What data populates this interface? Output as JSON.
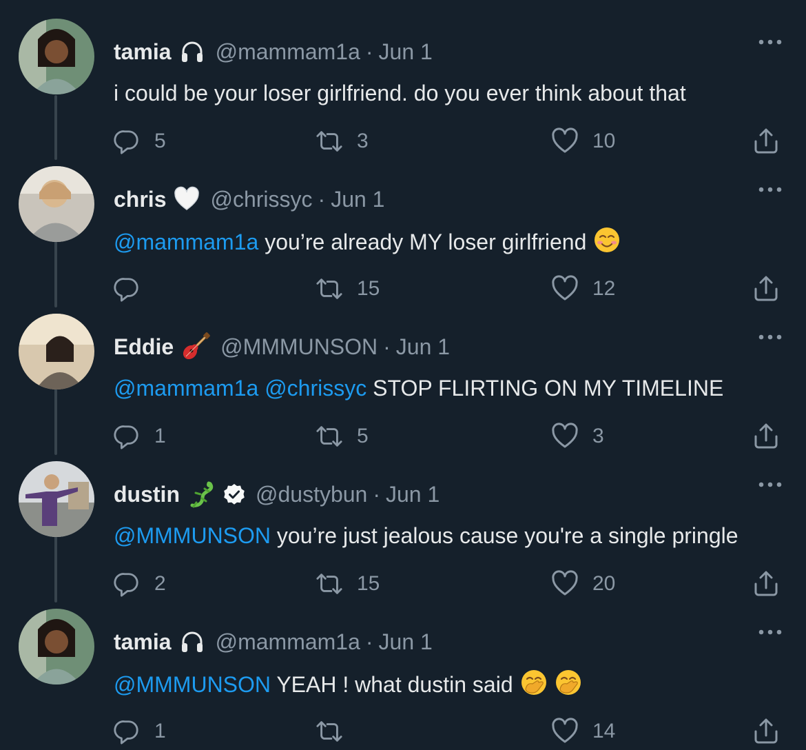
{
  "colors": {
    "background": "#15202b",
    "text": "#e7e9ea",
    "muted": "#8b98a5",
    "mention": "#1d9bf0",
    "thread_line": "#38444d"
  },
  "tweets": [
    {
      "name": "tamia",
      "name_emoji": "headphones-icon",
      "handle": "@mammam1a",
      "separator": "·",
      "date": "Jun 1",
      "mentions": [],
      "text": "i could be your loser girlfriend. do you ever think about that",
      "text_emojis": [],
      "reply_count": "5",
      "retweet_count": "3",
      "like_count": "10"
    },
    {
      "name": "chris",
      "name_emoji": "white-heart-icon",
      "handle": "@chrissyc",
      "separator": "·",
      "date": "Jun 1",
      "mentions": [
        "@mammam1a"
      ],
      "text": "you’re already MY loser girlfriend",
      "text_emojis": [
        "smiling-face-icon"
      ],
      "reply_count": "",
      "retweet_count": "15",
      "like_count": "12"
    },
    {
      "name": "Eddie",
      "name_emoji": "guitar-icon",
      "handle": "@MMMUNSON",
      "separator": "·",
      "date": "Jun 1",
      "mentions": [
        "@mammam1a",
        "@chrissyc"
      ],
      "text": "STOP FLIRTING ON MY TIMELINE",
      "text_emojis": [],
      "reply_count": "1",
      "retweet_count": "5",
      "like_count": "3"
    },
    {
      "name": "dustin",
      "name_emoji": "lizard-icon",
      "verified": true,
      "handle": "@dustybun",
      "separator": "·",
      "date": "Jun 1",
      "mentions": [
        "@MMMUNSON"
      ],
      "text": "you’re just jealous cause you're a single pringle",
      "text_emojis": [],
      "reply_count": "2",
      "retweet_count": "15",
      "like_count": "20"
    },
    {
      "name": "tamia",
      "name_emoji": "headphones-icon",
      "handle": "@mammam1a",
      "separator": "·",
      "date": "Jun 1",
      "mentions": [
        "@MMMUNSON"
      ],
      "text": "YEAH ! what dustin said",
      "text_emojis": [
        "hand-over-mouth-icon",
        "hand-over-mouth-icon"
      ],
      "reply_count": "1",
      "retweet_count": "",
      "like_count": "14"
    }
  ]
}
